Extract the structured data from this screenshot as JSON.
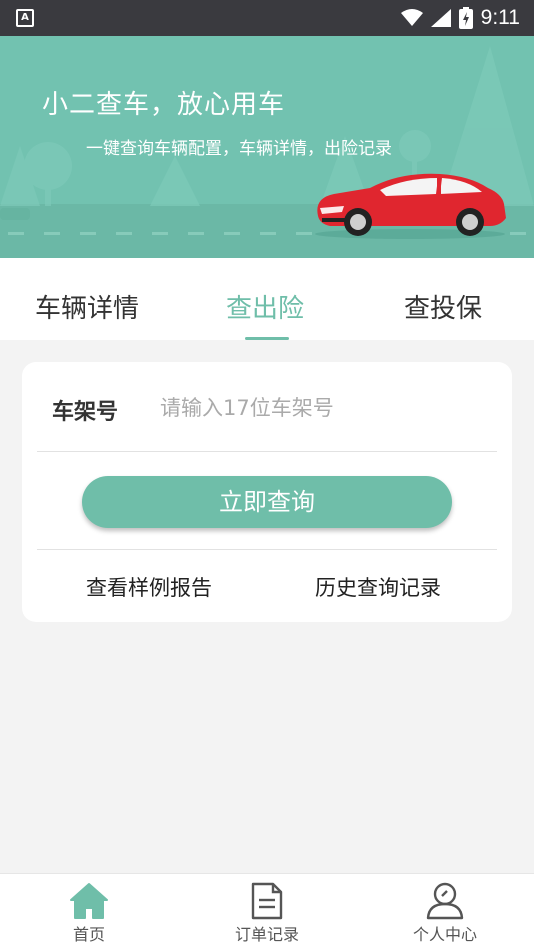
{
  "status_bar": {
    "time": "9:11",
    "notification_icon": "a-icon"
  },
  "banner": {
    "title": "小二查车，放心用车",
    "subtitle": "一键查询车辆配置，车辆详情，出险记录"
  },
  "tabs": [
    {
      "label": "车辆详情",
      "active": false
    },
    {
      "label": "查出险",
      "active": true
    },
    {
      "label": "查投保",
      "active": false
    }
  ],
  "form": {
    "vin_label": "车架号",
    "vin_placeholder": "请输入17位车架号",
    "vin_value": "",
    "submit_label": "立即查询",
    "sample_report_label": "查看样例报告",
    "history_label": "历史查询记录"
  },
  "bottom_nav": [
    {
      "label": "首页",
      "icon": "home-icon",
      "active": true
    },
    {
      "label": "订单记录",
      "icon": "document-icon",
      "active": false
    },
    {
      "label": "个人中心",
      "icon": "user-icon",
      "active": false
    }
  ],
  "colors": {
    "accent": "#6fbea9",
    "banner": "#72c2b0",
    "status_bar": "#3a3a3f",
    "car": "#e0262f"
  }
}
